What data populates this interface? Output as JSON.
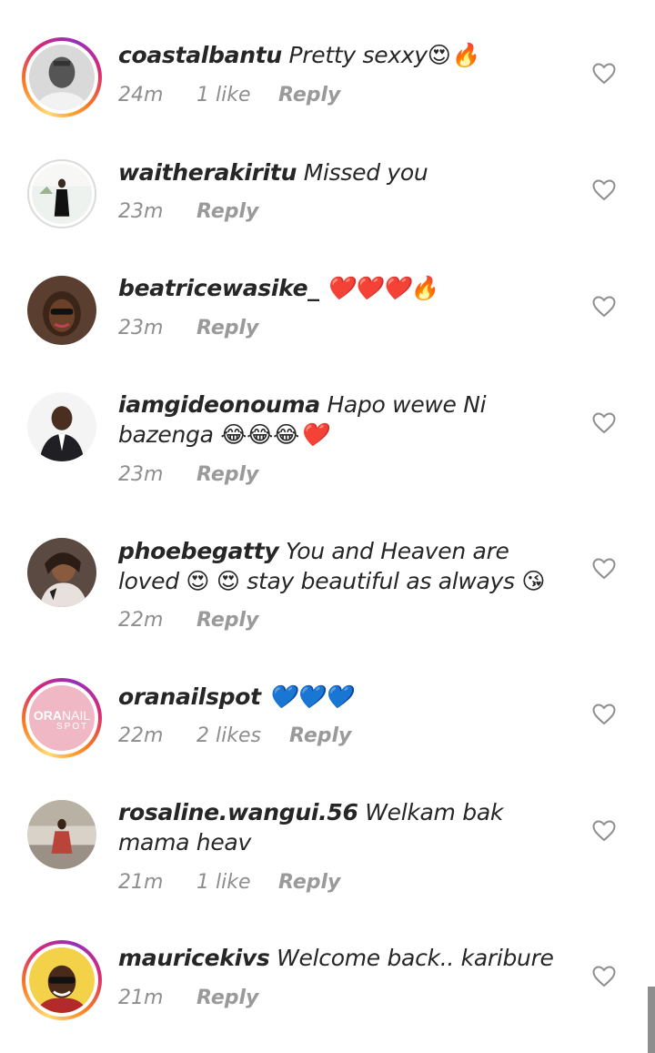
{
  "comments": [
    {
      "username": "coastalbantu",
      "text": "Pretty sexxy😍🔥",
      "time": "24m",
      "likes": "1 like",
      "reply": "Reply",
      "story_ring": true
    },
    {
      "username": "waitherakiritu",
      "text": "Missed you",
      "time": "23m",
      "likes": "",
      "reply": "Reply",
      "story_ring": false
    },
    {
      "username": "beatricewasike_",
      "text": "❤️❤️❤️🔥",
      "time": "23m",
      "likes": "",
      "reply": "Reply",
      "story_ring": false
    },
    {
      "username": "iamgideonouma",
      "text": "Hapo wewe Ni bazenga 😂😂😂❤️",
      "time": "23m",
      "likes": "",
      "reply": "Reply",
      "story_ring": false
    },
    {
      "username": "phoebegatty",
      "text": "You and Heaven are loved 😍 😍 stay beautiful as always 😘",
      "time": "22m",
      "likes": "",
      "reply": "Reply",
      "story_ring": false
    },
    {
      "username": "oranailspot",
      "text": "💙💙💙",
      "time": "22m",
      "likes": "2 likes",
      "reply": "Reply",
      "story_ring": true,
      "avatar_text_a": "ORA",
      "avatar_text_b": "NAIL",
      "avatar_text_c": "SPOT"
    },
    {
      "username": "rosaline.wangui.56",
      "text": "Welkam bak mama heav",
      "time": "21m",
      "likes": "1 like",
      "reply": "Reply",
      "story_ring": false
    },
    {
      "username": "mauricekivs",
      "text": "Welcome back.. karibure",
      "time": "21m",
      "likes": "",
      "reply": "Reply",
      "story_ring": true
    }
  ],
  "icons": {
    "like": "heart-outline-icon"
  },
  "colors": {
    "text": "#262626",
    "meta": "#8e8e8e",
    "story_ring_start": "#feda75",
    "story_ring_mid": "#d62976",
    "story_ring_end": "#962fbf"
  }
}
